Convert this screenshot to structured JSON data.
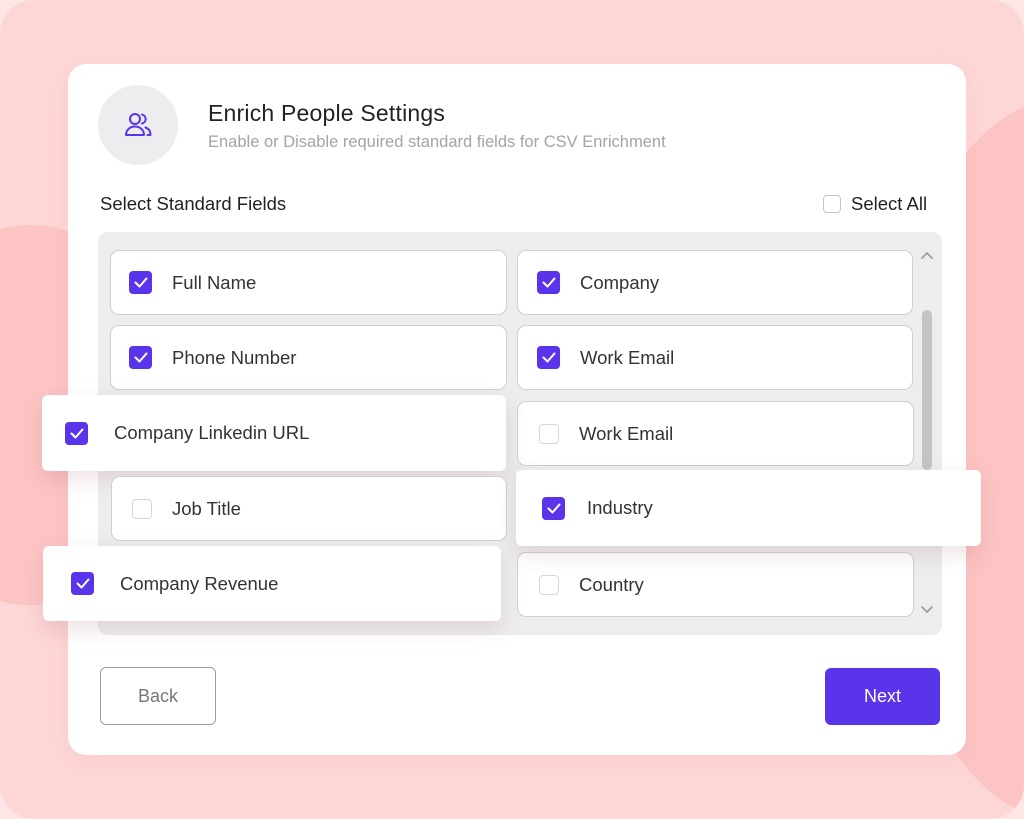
{
  "header": {
    "title": "Enrich People Settings",
    "subtitle": "Enable or Disable required standard fields for CSV Enrichment",
    "icon": "users-icon"
  },
  "section": {
    "label": "Select Standard Fields",
    "select_all_label": "Select All",
    "select_all_checked": false
  },
  "fields": [
    {
      "label": "Full Name",
      "checked": true
    },
    {
      "label": "Company",
      "checked": true
    },
    {
      "label": "Phone Number",
      "checked": true
    },
    {
      "label": "Work Email",
      "checked": true
    },
    {
      "label": "Company Linkedin URL",
      "checked": true
    },
    {
      "label": "Work Email",
      "checked": false
    },
    {
      "label": "Job Title",
      "checked": false
    },
    {
      "label": "Industry",
      "checked": true
    },
    {
      "label": "Company Revenue",
      "checked": true
    },
    {
      "label": "Country",
      "checked": false
    }
  ],
  "buttons": {
    "back_label": "Back",
    "next_label": "Next"
  },
  "colors": {
    "accent": "#5a34ea",
    "background": "#fdd7d6"
  }
}
